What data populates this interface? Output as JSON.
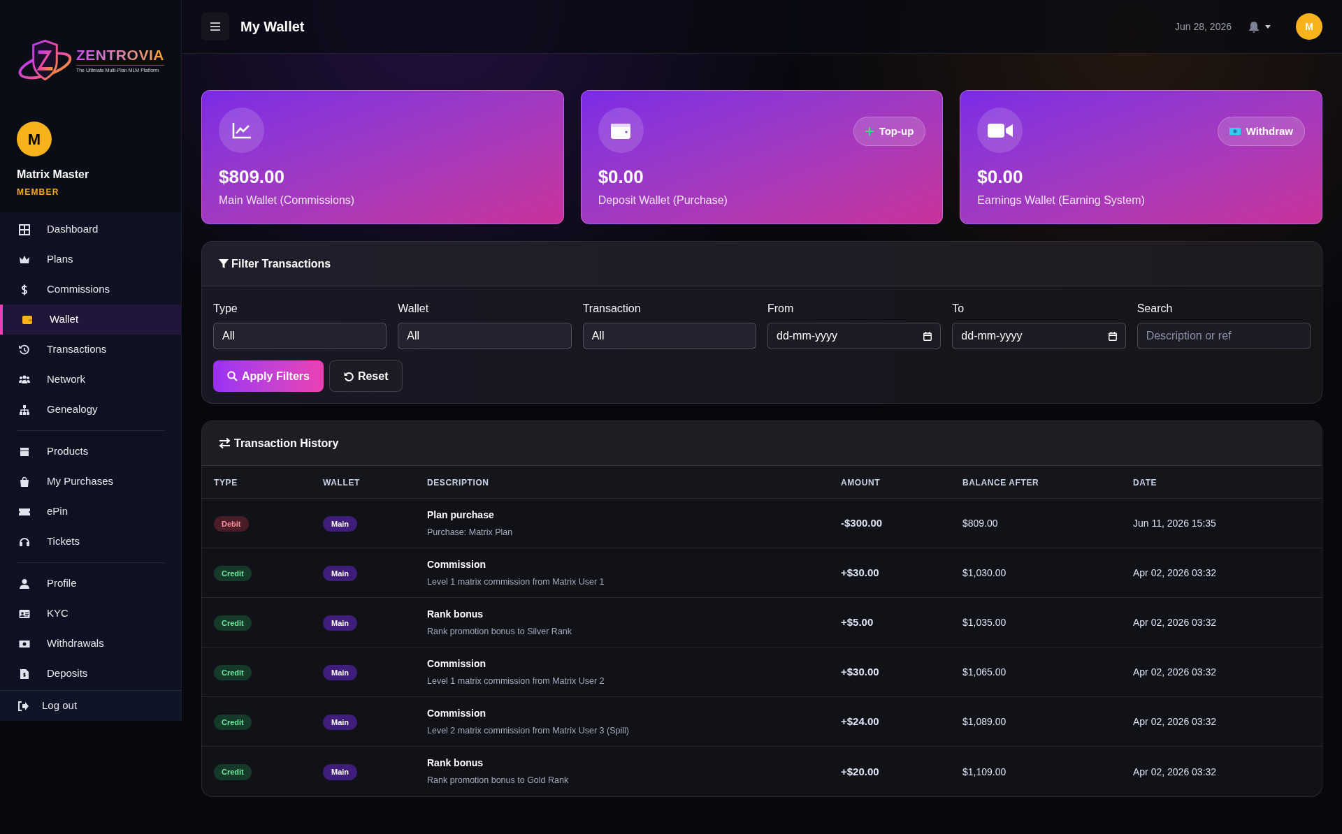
{
  "sidebar": {
    "logo": {
      "name": "ZENTROVIA",
      "tagline": "The Ultimate Multi-Plan MLM Platform"
    },
    "user": {
      "initial": "M",
      "name": "Matrix Master",
      "role": "MEMBER"
    },
    "groups": [
      [
        {
          "label": "Dashboard",
          "selected": false
        },
        {
          "label": "Plans",
          "selected": false
        },
        {
          "label": "Commissions",
          "selected": false
        },
        {
          "label": "Wallet",
          "selected": true
        },
        {
          "label": "Transactions",
          "selected": false
        },
        {
          "label": "Network",
          "selected": false
        },
        {
          "label": "Genealogy",
          "selected": false
        }
      ],
      [
        {
          "label": "Products",
          "selected": false
        },
        {
          "label": "My Purchases",
          "selected": false
        },
        {
          "label": "ePin",
          "selected": false
        },
        {
          "label": "Tickets",
          "selected": false
        }
      ],
      [
        {
          "label": "Profile",
          "selected": false
        },
        {
          "label": "KYC",
          "selected": false
        },
        {
          "label": "Withdrawals",
          "selected": false
        },
        {
          "label": "Deposits",
          "selected": false
        }
      ]
    ],
    "logout": "Log out"
  },
  "topbar": {
    "title": "My Wallet",
    "date": "Jun 28, 2026",
    "avatar": "M"
  },
  "wallets": [
    {
      "amount": "$809.00",
      "label": "Main Wallet (Commissions)"
    },
    {
      "amount": "$0.00",
      "label": "Deposit Wallet (Purchase)",
      "action": {
        "label": "Top-up",
        "kind": "topup"
      }
    },
    {
      "amount": "$0.00",
      "label": "Earnings Wallet (Earning System)",
      "action": {
        "label": "Withdraw",
        "kind": "withdraw"
      }
    }
  ],
  "filters": {
    "title": "Filter Transactions",
    "fields": [
      {
        "label": "Type",
        "kind": "select",
        "value": "All"
      },
      {
        "label": "Wallet",
        "kind": "select",
        "value": "All"
      },
      {
        "label": "Transaction",
        "kind": "select",
        "value": "All"
      },
      {
        "label": "From",
        "kind": "date",
        "value": "dd-mm-yyyy"
      },
      {
        "label": "To",
        "kind": "date",
        "value": "dd-mm-yyyy"
      },
      {
        "label": "Search",
        "kind": "text",
        "placeholder": "Description or ref"
      }
    ],
    "apply": "Apply Filters",
    "reset": "Reset"
  },
  "table": {
    "title": "Transaction History",
    "columns": [
      "TYPE",
      "WALLET",
      "DESCRIPTION",
      "AMOUNT",
      "BALANCE AFTER",
      "DATE"
    ],
    "rows": [
      {
        "type": {
          "label": "Debit",
          "kind": "debit"
        },
        "wallet": "Main",
        "title": "Plan purchase",
        "detail": "Purchase: Matrix Plan",
        "amount": "-$300.00",
        "balance": "$809.00",
        "date": "Jun 11, 2026 15:35"
      },
      {
        "type": {
          "label": "Credit",
          "kind": "credit"
        },
        "wallet": "Main",
        "title": "Commission",
        "detail": "Level 1 matrix commission from Matrix User 1",
        "amount": "+$30.00",
        "balance": "$1,030.00",
        "date": "Apr 02, 2026 03:32"
      },
      {
        "type": {
          "label": "Credit",
          "kind": "credit"
        },
        "wallet": "Main",
        "title": "Rank bonus",
        "detail": "Rank promotion bonus to Silver Rank",
        "amount": "+$5.00",
        "balance": "$1,035.00",
        "date": "Apr 02, 2026 03:32"
      },
      {
        "type": {
          "label": "Credit",
          "kind": "credit"
        },
        "wallet": "Main",
        "title": "Commission",
        "detail": "Level 1 matrix commission from Matrix User 2",
        "amount": "+$30.00",
        "balance": "$1,065.00",
        "date": "Apr 02, 2026 03:32"
      },
      {
        "type": {
          "label": "Credit",
          "kind": "credit"
        },
        "wallet": "Main",
        "title": "Commission",
        "detail": "Level 2 matrix commission from Matrix User 3 (Spill)",
        "amount": "+$24.00",
        "balance": "$1,089.00",
        "date": "Apr 02, 2026 03:32"
      },
      {
        "type": {
          "label": "Credit",
          "kind": "credit"
        },
        "wallet": "Main",
        "title": "Rank bonus",
        "detail": "Rank promotion bonus to Gold Rank",
        "amount": "+$20.00",
        "balance": "$1,109.00",
        "date": "Apr 02, 2026 03:32"
      }
    ]
  }
}
